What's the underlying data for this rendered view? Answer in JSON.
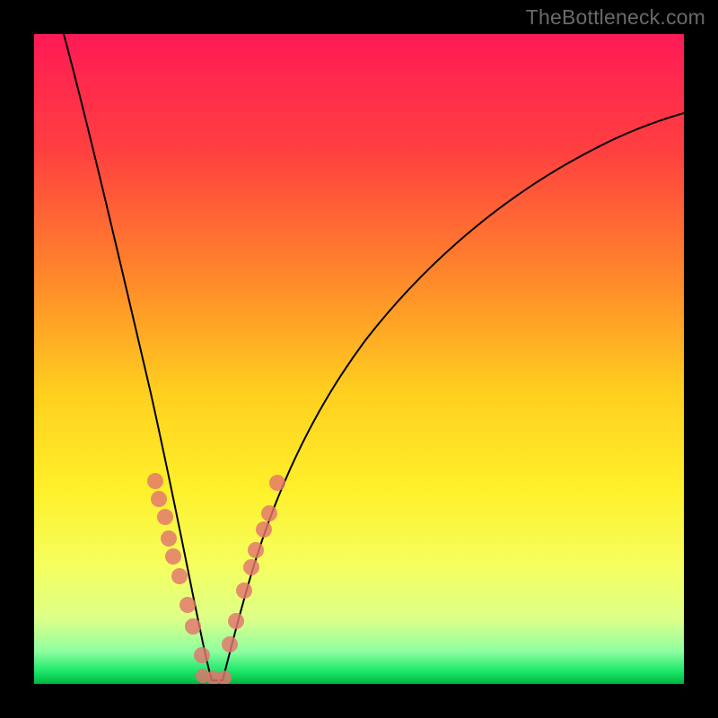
{
  "watermark": "TheBottleneck.com",
  "chart_data": {
    "type": "line",
    "title": "",
    "xlabel": "",
    "ylabel": "",
    "series": [
      {
        "name": "curve",
        "comment": "V-shaped curve over rainbow gradient; y≈0 at the trough near x≈0.27, rising steeply left and more gently right. No numeric axes are shown.",
        "x": [
          0.0,
          0.05,
          0.1,
          0.15,
          0.2,
          0.24,
          0.27,
          0.3,
          0.34,
          0.4,
          0.5,
          0.6,
          0.7,
          0.8,
          0.9,
          1.0
        ],
        "y": [
          1.0,
          0.82,
          0.62,
          0.43,
          0.23,
          0.07,
          0.0,
          0.06,
          0.18,
          0.33,
          0.5,
          0.62,
          0.71,
          0.78,
          0.83,
          0.87
        ]
      },
      {
        "name": "markers",
        "comment": "Salmon dot clusters along both legs of the V near the trough.",
        "x": [
          0.185,
          0.19,
          0.2,
          0.207,
          0.214,
          0.222,
          0.235,
          0.245,
          0.258,
          0.275,
          0.3,
          0.31,
          0.322,
          0.335,
          0.338,
          0.352,
          0.362,
          0.373
        ],
        "y": [
          0.3,
          0.275,
          0.245,
          0.215,
          0.19,
          0.16,
          0.115,
          0.085,
          0.04,
          0.0,
          0.055,
          0.09,
          0.14,
          0.175,
          0.2,
          0.235,
          0.26,
          0.3
        ]
      }
    ],
    "background_gradient": {
      "from_top": [
        "#ff1a55",
        "#ff5a3a",
        "#ffb128",
        "#ffe92a",
        "#f7ff55",
        "#c9ffa0",
        "#00e552",
        "#00b63e"
      ]
    },
    "xlim": [
      0,
      1
    ],
    "ylim": [
      0,
      1
    ],
    "axes_visible": false
  }
}
